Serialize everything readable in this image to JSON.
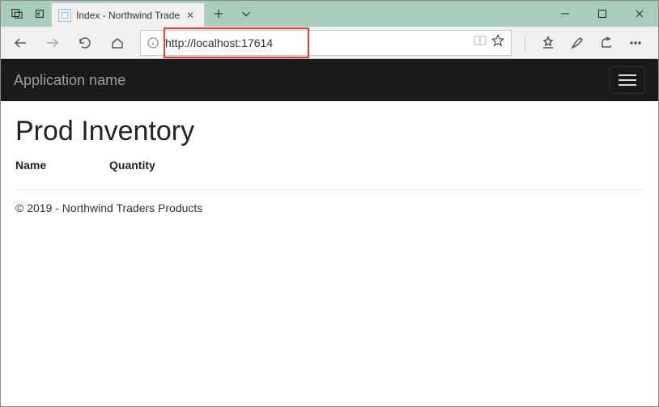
{
  "titlebar": {
    "tab_title": "Index - Northwind Trade"
  },
  "toolbar": {
    "url": "http://localhost:17614"
  },
  "page": {
    "brand": "Application name",
    "heading": "Prod Inventory",
    "columns": {
      "name": "Name",
      "quantity": "Quantity"
    },
    "footer": "© 2019 - Northwind Traders Products"
  }
}
